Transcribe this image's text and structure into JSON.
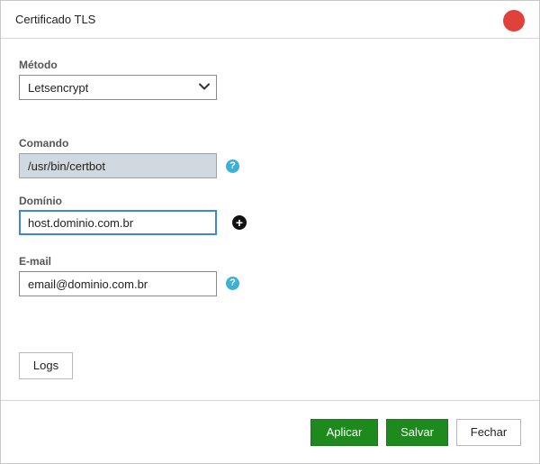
{
  "dialog": {
    "title": "Certificado TLS",
    "close_color": "#e0413a"
  },
  "form": {
    "metodo": {
      "label": "Método",
      "value": "Letsencrypt"
    },
    "comando": {
      "label": "Comando",
      "value": "/usr/bin/certbot"
    },
    "dominio": {
      "label": "Domínio",
      "value": "host.dominio.com.br"
    },
    "email": {
      "label": "E-mail",
      "value": "email@dominio.com.br"
    }
  },
  "buttons": {
    "logs": "Logs",
    "aplicar": "Aplicar",
    "salvar": "Salvar",
    "fechar": "Fechar"
  },
  "icons": {
    "help": "?",
    "add": "+"
  },
  "colors": {
    "primary": "#1e8a1e",
    "help": "#38b2d8",
    "focus": "#3b88d8",
    "readonly_bg": "#d0d9df"
  }
}
